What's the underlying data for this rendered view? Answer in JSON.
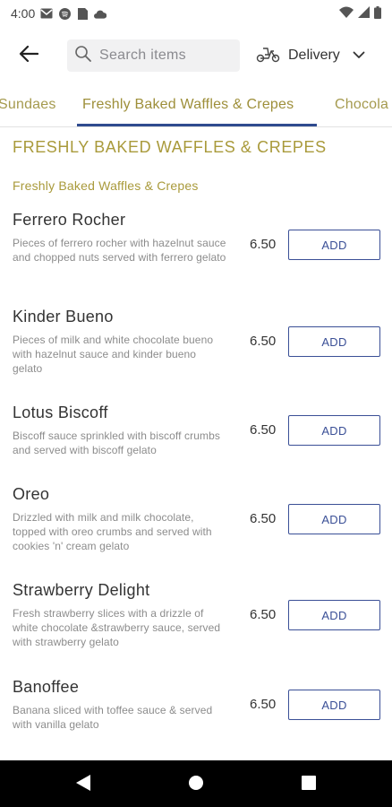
{
  "status": {
    "time": "4:00"
  },
  "header": {
    "search_placeholder": "Search items",
    "delivery_label": "Delivery"
  },
  "tabs": [
    {
      "label": "Sundaes"
    },
    {
      "label": "Freshly Baked Waffles & Crepes"
    },
    {
      "label": "Chocola"
    }
  ],
  "section": {
    "title": "FRESHLY BAKED WAFFLES & CREPES",
    "subtitle": "Freshly Baked Waffles & Crepes"
  },
  "items": [
    {
      "name": "Ferrero Rocher",
      "desc": "Pieces of ferrero rocher with hazelnut sauce and chopped nuts served with ferrero gelato",
      "price": "6.50",
      "add": "ADD"
    },
    {
      "name": "Kinder Bueno",
      "desc": "Pieces of milk and white chocolate bueno with hazelnut sauce and kinder bueno gelato",
      "price": "6.50",
      "add": "ADD"
    },
    {
      "name": "Lotus Biscoff",
      "desc": "Biscoff sauce sprinkled with biscoff crumbs and served with biscoff gelato",
      "price": "6.50",
      "add": "ADD"
    },
    {
      "name": "Oreo",
      "desc": "Drizzled with milk and milk chocolate, topped with oreo crumbs and served with cookies 'n' cream gelato",
      "price": "6.50",
      "add": "ADD"
    },
    {
      "name": "Strawberry Delight",
      "desc": "Fresh strawberry slices with a drizzle of white chocolate &strawberry sauce, served with strawberry gelato",
      "price": "6.50",
      "add": "ADD"
    },
    {
      "name": "Banoffee",
      "desc": "Banana sliced with toffee sauce & served with vanilla gelato",
      "price": "6.50",
      "add": "ADD"
    }
  ],
  "colors": {
    "accent": "#3a4f96",
    "gold": "#a99a3b"
  },
  "icons": {
    "status": [
      "gmail-icon",
      "spotify-icon",
      "sim-icon",
      "cloud-icon",
      "wifi-icon",
      "signal-icon",
      "battery-icon"
    ],
    "header": [
      "back-arrow-icon",
      "search-icon",
      "scooter-icon",
      "chevron-down-icon"
    ],
    "nav": [
      "back-triangle-icon",
      "home-circle-icon",
      "recents-square-icon"
    ]
  }
}
